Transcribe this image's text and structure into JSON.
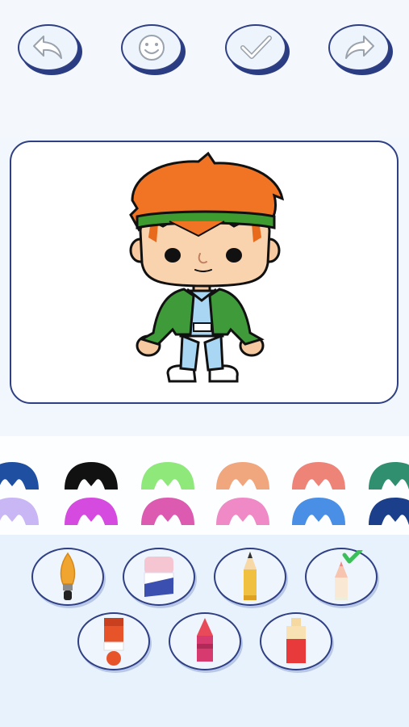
{
  "toolbar": {
    "buttons": [
      {
        "name": "undo-button",
        "icon": "undo-arrow-icon"
      },
      {
        "name": "face-stamp-button",
        "icon": "smiley-icon"
      },
      {
        "name": "done-button",
        "icon": "checkmark-icon"
      },
      {
        "name": "redo-button",
        "icon": "redo-arrow-icon"
      }
    ]
  },
  "colors": {
    "outline": "#2f3f83",
    "row1": [
      "#1e4fa0",
      "#111111",
      "#8fe87a",
      "#f0a77e",
      "#ee8478",
      "#2f8f6e"
    ],
    "row2": [
      "#c9b6f4",
      "#d54be0",
      "#dc5ab0",
      "#f08ac6",
      "#4a8fe6",
      "#1b3f8a"
    ]
  },
  "tools": [
    {
      "name": "paintbrush-tool",
      "icon": "paintbrush-icon"
    },
    {
      "name": "eraser-tool",
      "icon": "eraser-icon"
    },
    {
      "name": "pencil-tool",
      "icon": "pencil-icon"
    },
    {
      "name": "colored-pencil-tool",
      "icon": "colored-pencil-icon",
      "selected": true
    },
    {
      "name": "paint-tube-tool",
      "icon": "paint-tube-icon"
    },
    {
      "name": "crayon-tool",
      "icon": "crayon-icon"
    },
    {
      "name": "marker-tool",
      "icon": "marker-icon"
    }
  ]
}
